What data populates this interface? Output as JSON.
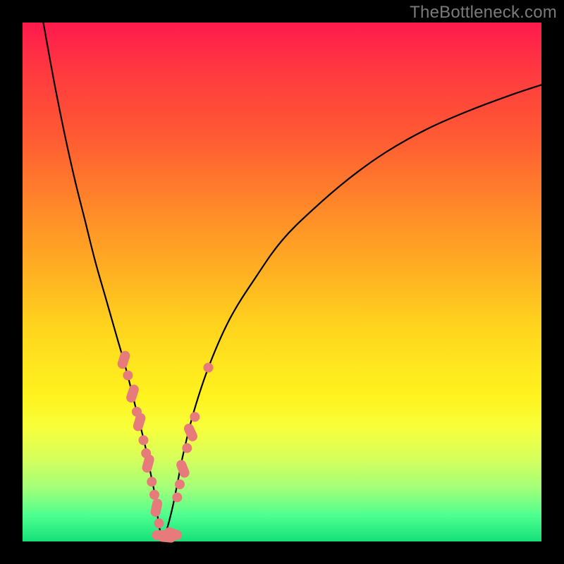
{
  "watermark": "TheBottleneck.com",
  "colors": {
    "frame": "#000000",
    "gradient_top": "#ff1a4d",
    "gradient_mid": "#ffd21e",
    "gradient_bottom": "#16e07a",
    "curve": "#000000",
    "marker": "#e77a7a"
  },
  "chart_data": {
    "type": "line",
    "title": "",
    "xlabel": "",
    "ylabel": "",
    "xlim": [
      0,
      100
    ],
    "ylim": [
      0,
      100
    ],
    "grid": false,
    "series": [
      {
        "name": "left_branch",
        "x": [
          4,
          6,
          8,
          10,
          12,
          14,
          16,
          18,
          20,
          22,
          23.5,
          24.5,
          25.5,
          26,
          26.5,
          27
        ],
        "y": [
          100,
          89,
          79,
          70,
          62,
          54,
          47,
          40,
          33,
          25,
          19,
          14,
          9,
          5,
          2,
          0
        ]
      },
      {
        "name": "right_branch",
        "x": [
          27,
          28,
          29,
          30,
          31,
          33,
          36,
          40,
          45,
          50,
          56,
          63,
          70,
          78,
          86,
          94,
          100
        ],
        "y": [
          0,
          3,
          7,
          12,
          17,
          25,
          34,
          43,
          51,
          58,
          64,
          70,
          75,
          79.5,
          83,
          86,
          88
        ]
      }
    ],
    "markers": [
      {
        "series": "left_branch",
        "x": 19.5,
        "y": 35,
        "shape": "pill",
        "angle": -72
      },
      {
        "series": "left_branch",
        "x": 20.3,
        "y": 32,
        "shape": "dot"
      },
      {
        "series": "left_branch",
        "x": 21.2,
        "y": 28.5,
        "shape": "pill",
        "angle": -72
      },
      {
        "series": "left_branch",
        "x": 22.0,
        "y": 25,
        "shape": "dot"
      },
      {
        "series": "left_branch",
        "x": 22.5,
        "y": 23,
        "shape": "pill",
        "angle": -73
      },
      {
        "series": "left_branch",
        "x": 23.3,
        "y": 19.5,
        "shape": "dot"
      },
      {
        "series": "left_branch",
        "x": 23.8,
        "y": 17,
        "shape": "dot"
      },
      {
        "series": "left_branch",
        "x": 24.2,
        "y": 15,
        "shape": "pill",
        "angle": -75
      },
      {
        "series": "left_branch",
        "x": 24.9,
        "y": 11.5,
        "shape": "dot"
      },
      {
        "series": "left_branch",
        "x": 25.4,
        "y": 9,
        "shape": "dot"
      },
      {
        "series": "left_branch",
        "x": 25.8,
        "y": 6.5,
        "shape": "pill",
        "angle": -78
      },
      {
        "series": "left_branch",
        "x": 26.3,
        "y": 3.5,
        "shape": "dot"
      },
      {
        "series": "valley",
        "x": 26.7,
        "y": 1.2,
        "shape": "pill",
        "angle": 0
      },
      {
        "series": "valley",
        "x": 27.8,
        "y": 0.8,
        "shape": "pill",
        "angle": 5
      },
      {
        "series": "valley",
        "x": 29.0,
        "y": 1.5,
        "shape": "pill",
        "angle": 20
      },
      {
        "series": "right_branch",
        "x": 29.8,
        "y": 8.5,
        "shape": "dot"
      },
      {
        "series": "right_branch",
        "x": 30.3,
        "y": 11,
        "shape": "dot"
      },
      {
        "series": "right_branch",
        "x": 30.9,
        "y": 14,
        "shape": "pill",
        "angle": 68
      },
      {
        "series": "right_branch",
        "x": 31.7,
        "y": 18,
        "shape": "dot"
      },
      {
        "series": "right_branch",
        "x": 32.4,
        "y": 21,
        "shape": "pill",
        "angle": 65
      },
      {
        "series": "right_branch",
        "x": 33.2,
        "y": 24,
        "shape": "dot"
      },
      {
        "series": "right_branch",
        "x": 35.8,
        "y": 33.5,
        "shape": "dot"
      }
    ],
    "annotations": []
  }
}
